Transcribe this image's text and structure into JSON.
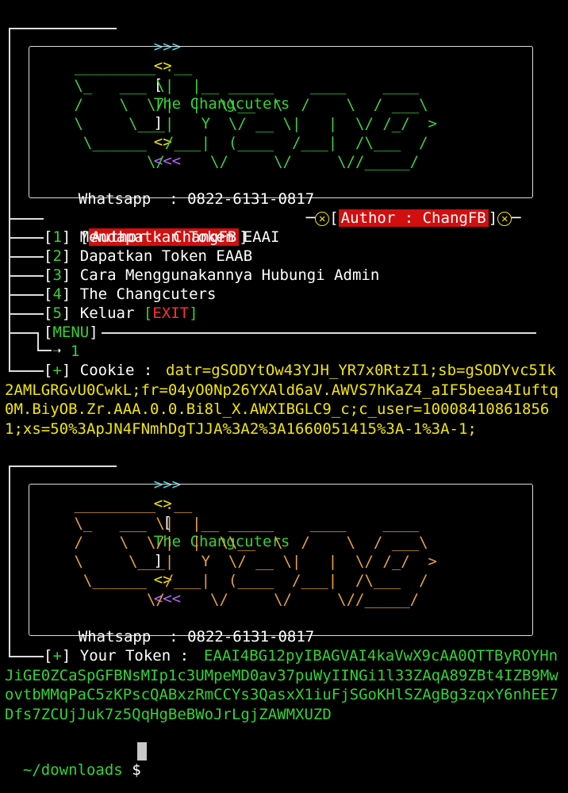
{
  "section1": {
    "header": {
      "arrows_left": ">>>",
      "diamond": "<>",
      "title": "The Changcuters",
      "arrows_right": "<<<"
    },
    "ascii_logo": " _________ .__\n \\_   ___ \\|  |__ _____    ____    ____\n /    \\  \\/|  |  \\\\__  \\  /    \\  / ___\\\n \\     \\___|   Y  \\/ __ \\|   |  \\/ /_/  >\n  \\______  /___|  (____  /___|  /\\___  /\n         \\/     \\/     \\/     \\//_____/",
    "whatsapp_label": "Whatsapp",
    "whatsapp_sep": ":",
    "whatsapp_number": "0822-6131-0817",
    "author_badge": "Author : ChangFB",
    "menu_author_badge": "Author : ChangFB",
    "menu_items": [
      {
        "num": "1",
        "label": "Mendapatkan Token EAAI",
        "extra": ""
      },
      {
        "num": "2",
        "label": "Dapatkan Token EAAB",
        "extra": ""
      },
      {
        "num": "3",
        "label": "Cara Menggunakannya Hubungi Admin",
        "extra": ""
      },
      {
        "num": "4",
        "label": "The Changcuters",
        "extra": ""
      },
      {
        "num": "5",
        "label": "Keluar",
        "extra": "EXIT"
      }
    ],
    "menu_label": "MENU",
    "menu_input": "1",
    "cookie_marker": "+",
    "cookie_label": "Cookie :",
    "cookie_value": "datr=gSODYtOw43YJH_YR7x0RtzI1;sb=gSODYvc5Ik2AMLGRGvU0CwkL;fr=04yO0Np26YXAld6aV.AWVS7hKaZ4_aIF5beea4Iuftq0M.BiyOB.Zr.AAA.0.0.Bi8l_X.AWXIBGLC9_c;c_user=100084108618561;xs=50%3ApJN4FNmhDgTJJA%3A2%3A1660051415%3A-1%3A-1;"
  },
  "section2": {
    "header": {
      "arrows_left": ">>>",
      "diamond": "<>",
      "title": "The Changcuters",
      "arrows_right": "<<<"
    },
    "whatsapp_label": "Whatsapp",
    "whatsapp_sep": ":",
    "whatsapp_number": "0822-6131-0817",
    "token_marker": "+",
    "token_label": "Your Token :",
    "token_value": "EAAI4BG12pyIBAGVAI4kaVwX9cAA0QTTByROYHnJiGE0ZCaSpGFBNsMIp1c3UMpeMD0av37puWyIINGi1l33ZAqA89ZBt4IZB9MwovtbMMqPaC5zKPscQABxzRmCCYs3QasxX1iuFjSGoKHlSZAgBg3zqxY6nhEE7Dfs7ZCUjJuk7z5QqHgBeBWoJrLgjZAWMXUZD"
  },
  "prompt": {
    "path": "~/downloads",
    "symbol": "$"
  },
  "colors": {
    "background": "#000000",
    "yellow": "#f2e600",
    "green": "#33d333",
    "red_badge": "#d10f0f",
    "orange_logo": "#e9a13c",
    "cyan": "#4fd9e8",
    "purple": "#b06cf0"
  }
}
